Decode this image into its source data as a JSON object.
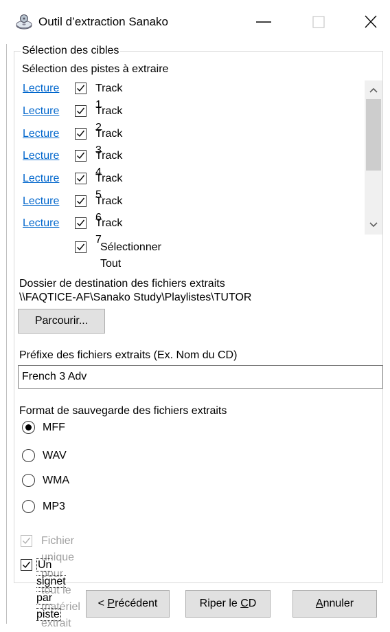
{
  "window": {
    "title": "Outil d’extraction Sanako",
    "app_icon": "cd-disc-icon"
  },
  "targets_group": {
    "legend": "Sélection des cibles",
    "tracks_heading": "Sélection des pistes à extraire",
    "play_label": "Lecture",
    "tracks": [
      {
        "label": "Track 1",
        "checked": true
      },
      {
        "label": "Track 2",
        "checked": true
      },
      {
        "label": "Track 3",
        "checked": true
      },
      {
        "label": "Track 4",
        "checked": true
      },
      {
        "label": "Track 5",
        "checked": true
      },
      {
        "label": "Track 6",
        "checked": true
      },
      {
        "label": "Track 7",
        "checked": true
      }
    ],
    "select_all_label": "Sélectionner Tout",
    "select_all_checked": true
  },
  "destination": {
    "label": "Dossier de destination des fichiers extraits",
    "path": "\\\\FAQTICE-AF\\Sanako Study\\Playlistes\\TUTOR",
    "browse_label": "Parcourir..."
  },
  "prefix": {
    "label": "Préfixe des fichiers extraits (Ex. Nom du CD)",
    "value": "French 3 Adv"
  },
  "format": {
    "label": "Format de sauvegarde des fichiers extraits",
    "options": [
      "MFF",
      "WAV",
      "WMA",
      "MP3"
    ],
    "selected": "MFF"
  },
  "options": {
    "single_file_label": "Fichier unique pour tout le matériel extrait",
    "single_file_checked": true,
    "single_file_enabled": false,
    "bookmark_label": "Un signet par piste",
    "bookmark_checked": true
  },
  "buttons": {
    "prev_prefix": "< ",
    "prev_mnemonic": "P",
    "prev_rest": "récédent",
    "rip_prefix": "Riper le ",
    "rip_mnemonic": "C",
    "rip_rest": "D",
    "cancel_mnemonic": "A",
    "cancel_rest": "nnuler"
  }
}
